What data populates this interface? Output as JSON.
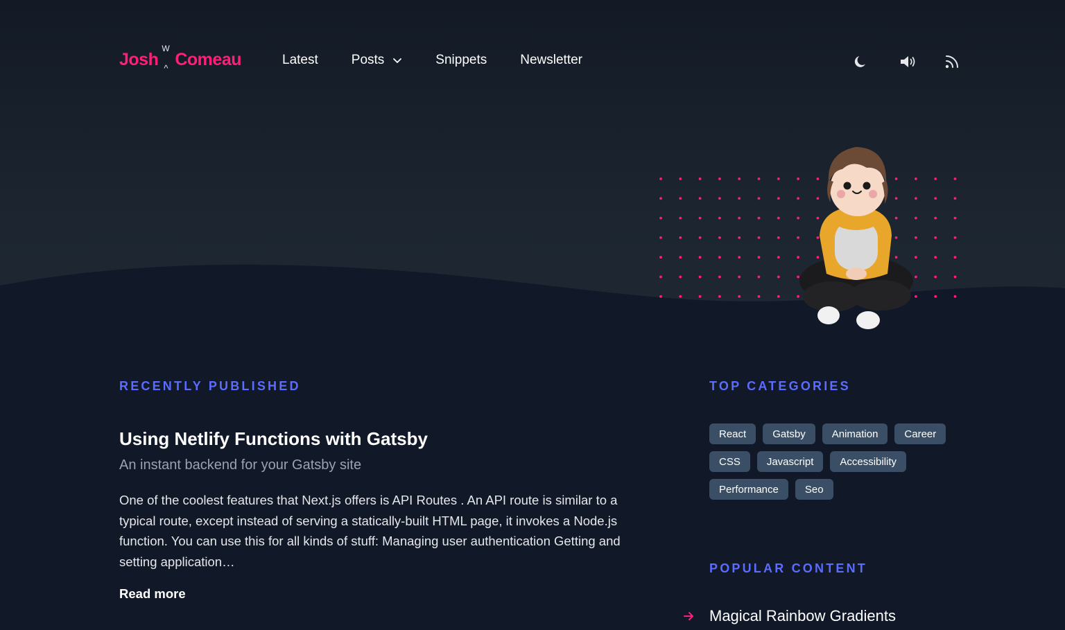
{
  "brand": {
    "first": "Josh",
    "w": "W",
    "caret": "^",
    "last": "Comeau",
    "color": "#ff1f7a"
  },
  "nav": {
    "items": [
      {
        "label": "Latest",
        "has_dropdown": false
      },
      {
        "label": "Posts",
        "has_dropdown": true
      },
      {
        "label": "Snippets",
        "has_dropdown": false
      },
      {
        "label": "Newsletter",
        "has_dropdown": false
      }
    ],
    "icons": [
      "moon-icon",
      "speaker-icon",
      "rss-icon"
    ]
  },
  "recently_published": {
    "heading": "RECENTLY PUBLISHED",
    "post": {
      "title": "Using Netlify Functions with Gatsby",
      "subtitle": "An instant backend for your Gatsby site",
      "excerpt": "One of the coolest features that Next.js offers is API Routes . An API route is similar to a typical route, except instead of serving a statically-built HTML page, it invokes a Node.js function. You can use this for all kinds of stuff: Managing user authentication Getting and setting application…",
      "read_more": "Read more"
    }
  },
  "top_categories": {
    "heading": "TOP CATEGORIES",
    "tags": [
      "React",
      "Gatsby",
      "Animation",
      "Career",
      "CSS",
      "Javascript",
      "Accessibility",
      "Performance",
      "Seo"
    ]
  },
  "popular_content": {
    "heading": "POPULAR CONTENT",
    "items": [
      "Magical Rainbow Gradients"
    ]
  },
  "colors": {
    "accent_blue": "#5b6cff",
    "accent_pink": "#ff1f7a",
    "tag_bg": "#3a4f66",
    "background": "#111827"
  }
}
